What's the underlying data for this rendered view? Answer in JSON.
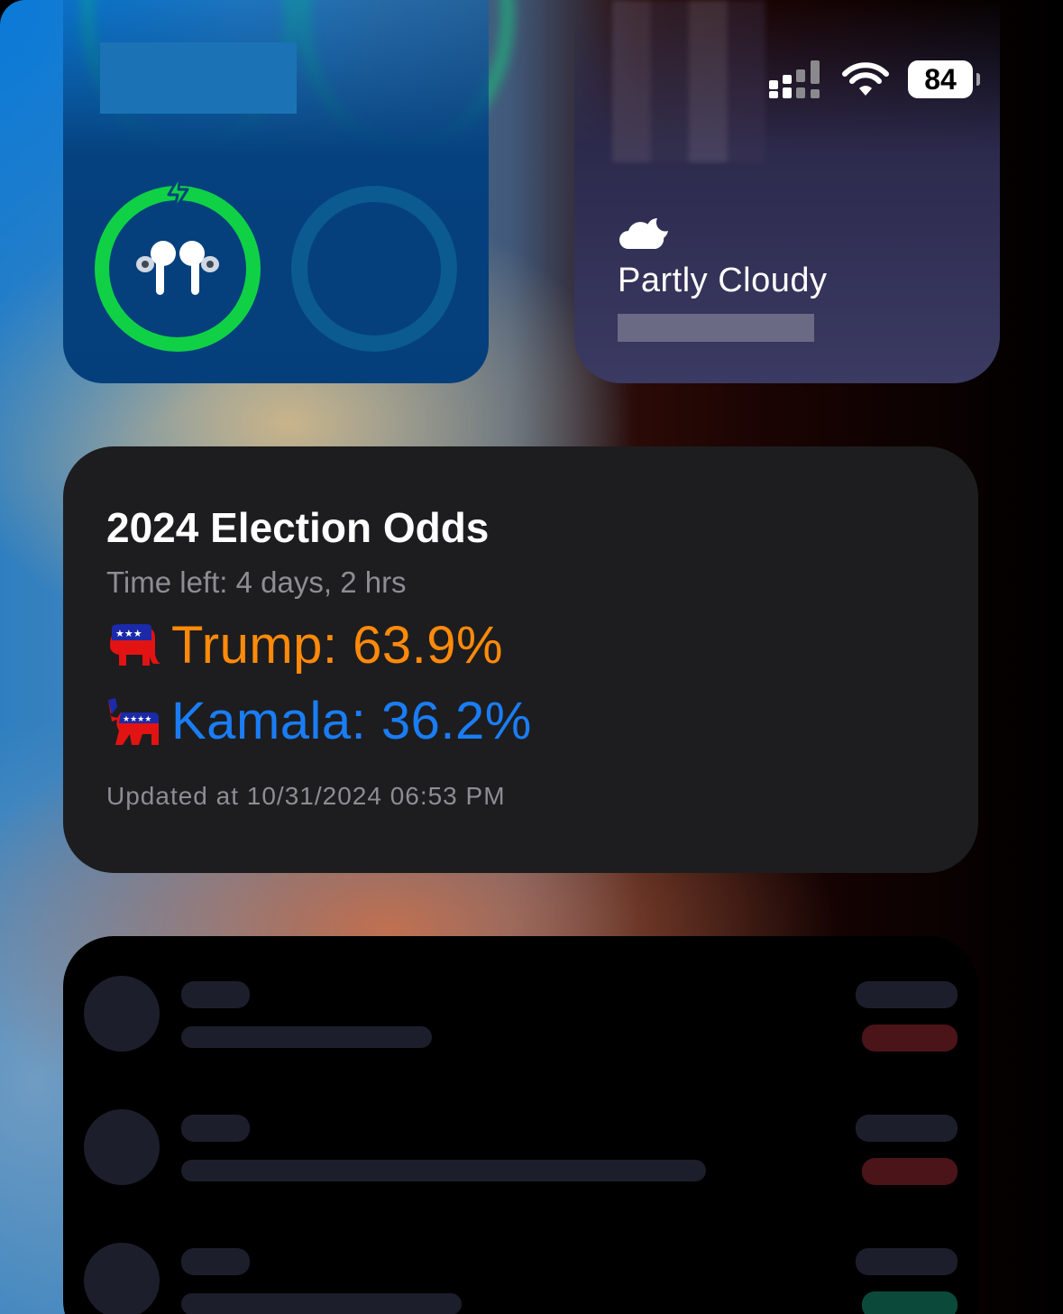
{
  "status_bar": {
    "battery_level": "84",
    "signal_icon": "cellular-signal-icon",
    "wifi_icon": "wifi-icon"
  },
  "airpods_widget": {
    "icon": "airpods-icon",
    "charging_icon": "charging-bolt-icon",
    "ring_color": "#10d146"
  },
  "weather_widget": {
    "icon": "partly-cloudy-night-icon",
    "condition": "Partly Cloudy"
  },
  "election_widget": {
    "title": "2024 Election Odds",
    "time_left": "Time left: 4 days, 2 hrs",
    "candidates": [
      {
        "label": "Trump: 63.9%",
        "party_icon": "republican-elephant-icon",
        "color": "#ff8a0a"
      },
      {
        "label": "Kamala: 36.2%",
        "party_icon": "democrat-donkey-icon",
        "color": "#1a7df5"
      }
    ],
    "updated": "Updated at 10/31/2024 06:53 PM"
  },
  "list_widget": {
    "rows": [
      {
        "badge_color": "#4a1418"
      },
      {
        "badge_color": "#4a1418"
      },
      {
        "badge_color": "#0b4a3a"
      }
    ]
  }
}
